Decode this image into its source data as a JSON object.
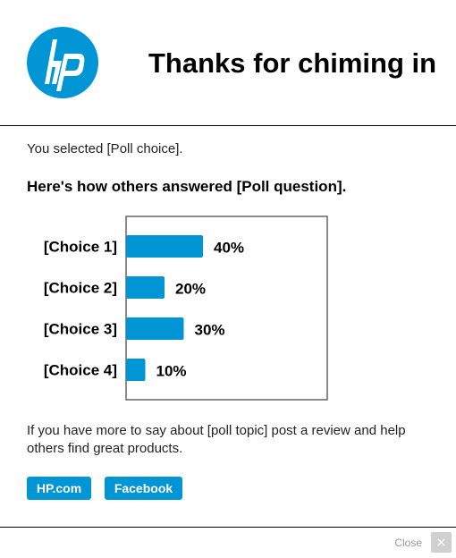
{
  "brand": {
    "color": "#0096d6",
    "logo_name": "hp-logo"
  },
  "header": {
    "title": "Thanks for chiming in"
  },
  "body": {
    "selected_text": "You selected [Poll choice].",
    "question_text": "Here's how others answered [Poll question].",
    "closing_text": "If you have more to say about [poll topic] post a review and help others find great products."
  },
  "chart_data": {
    "type": "bar",
    "orientation": "horizontal",
    "categories": [
      "[Choice 1]",
      "[Choice 2]",
      "[Choice 3]",
      "[Choice 4]"
    ],
    "values": [
      40,
      20,
      30,
      10
    ],
    "value_labels": [
      "40%",
      "20%",
      "30%",
      "10%"
    ],
    "xlim": [
      0,
      100
    ],
    "bar_color": "#0096d6",
    "grid": false
  },
  "buttons": {
    "hp_label": "HP.com",
    "facebook_label": "Facebook"
  },
  "footer": {
    "close_label": "Close",
    "close_icon": "close-icon"
  }
}
